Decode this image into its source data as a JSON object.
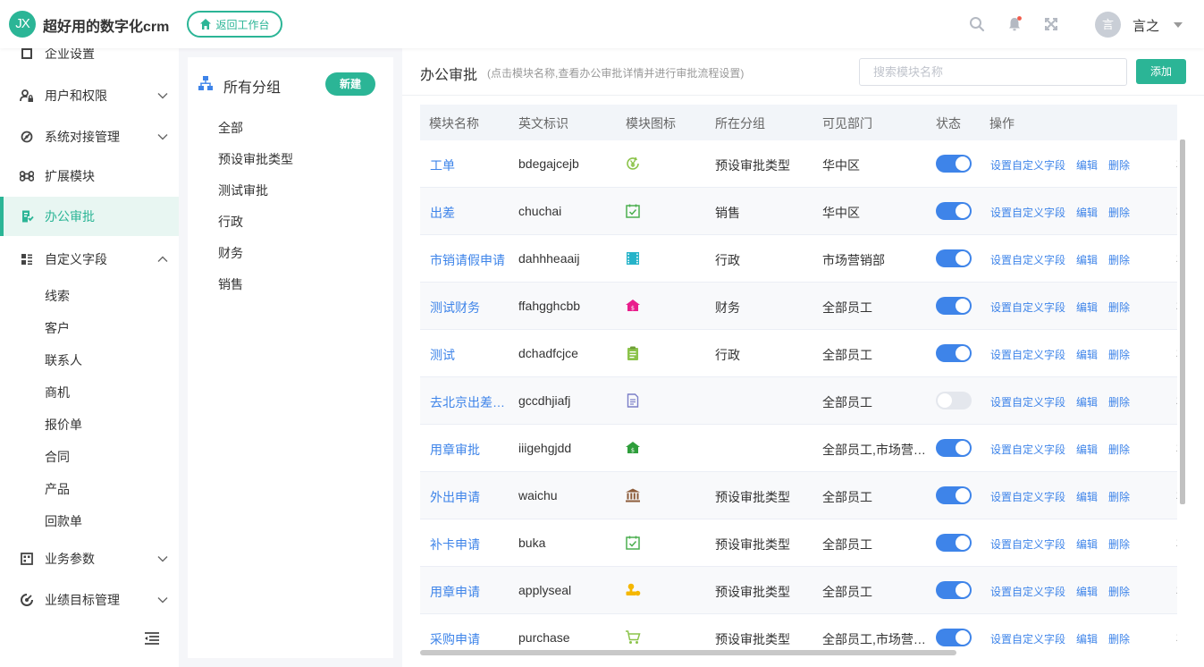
{
  "header": {
    "logo_text": "JX",
    "app_title": "超好用的数字化crm",
    "back_label": "返回工作台",
    "avatar_text": "言",
    "user_name": "言之"
  },
  "sidebar": {
    "top_partial": "企业设置",
    "items": [
      {
        "label": "用户和权限"
      },
      {
        "label": "系统对接管理"
      },
      {
        "label": "扩展模块"
      },
      {
        "label": "办公审批"
      },
      {
        "label": "自定义字段"
      },
      {
        "label": "业务参数"
      },
      {
        "label": "业绩目标管理"
      }
    ],
    "sub_items": [
      "线索",
      "客户",
      "联系人",
      "商机",
      "报价单",
      "合同",
      "产品",
      "回款单"
    ]
  },
  "groups": {
    "title": "所有分组",
    "new_label": "新建",
    "items": [
      "全部",
      "预设审批类型",
      "测试审批",
      "行政",
      "财务",
      "销售"
    ]
  },
  "main": {
    "title": "办公审批",
    "hint": "(点击模块名称,查看办公审批详情并进行审批流程设置)",
    "search_placeholder": "搜索模块名称",
    "add_label": "添加"
  },
  "table": {
    "headers": [
      "模块名称",
      "英文标识",
      "模块图标",
      "所在分组",
      "可见部门",
      "状态",
      "操作"
    ],
    "ops": [
      "设置自定义字段",
      "编辑",
      "删除"
    ],
    "rows": [
      {
        "name": "工单",
        "key": "bdegajcejb",
        "icon": "yen-cycle-icon",
        "group": "预设审批类型",
        "dept": "华中区",
        "on": true
      },
      {
        "name": "出差",
        "key": "chuchai",
        "icon": "calendar-check-icon",
        "group": "销售",
        "dept": "华中区",
        "on": true
      },
      {
        "name": "市销请假申请",
        "key": "dahhheaaij",
        "icon": "film-icon",
        "group": "行政",
        "dept": "市场营销部",
        "on": true
      },
      {
        "name": "测试财务",
        "key": "ffahgghcbb",
        "icon": "house-money-icon",
        "group": "财务",
        "dept": "全部员工",
        "on": true
      },
      {
        "name": "测试",
        "key": "dchadfcjce",
        "icon": "clipboard-icon",
        "group": "行政",
        "dept": "全部员工",
        "on": true
      },
      {
        "name": "去北京出差申请",
        "key": "gccdhjiafj",
        "icon": "document-icon",
        "group": "",
        "dept": "全部员工",
        "on": false
      },
      {
        "name": "用章审批",
        "key": "iiigehgjdd",
        "icon": "house-money-icon",
        "group": "",
        "dept": "全部员工,市场营销部",
        "on": true
      },
      {
        "name": "外出申请",
        "key": "waichu",
        "icon": "bank-icon",
        "group": "预设审批类型",
        "dept": "全部员工",
        "on": true
      },
      {
        "name": "补卡申请",
        "key": "buka",
        "icon": "calendar-check-icon",
        "group": "预设审批类型",
        "dept": "全部员工",
        "on": true
      },
      {
        "name": "用章申请",
        "key": "applyseal",
        "icon": "seal-icon",
        "group": "预设审批类型",
        "dept": "全部员工",
        "on": true
      },
      {
        "name": "采购申请",
        "key": "purchase",
        "icon": "cart-icon",
        "group": "预设审批类型",
        "dept": "全部员工,市场营销部",
        "on": true
      }
    ],
    "extra_char": "2"
  },
  "colors": {
    "brand": "#2bb596",
    "link": "#3e84e9"
  }
}
